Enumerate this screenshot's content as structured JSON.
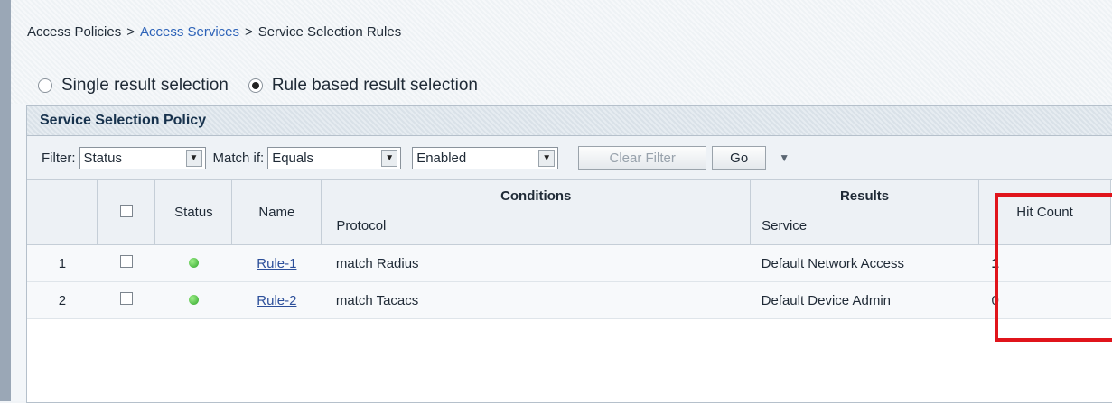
{
  "breadcrumb": {
    "item1": "Access Policies",
    "item2": "Access Services",
    "item3": "Service Selection Rules",
    "separator": ">"
  },
  "selection_mode": {
    "single": "Single result selection",
    "rule_based": "Rule based result selection",
    "selected": "rule_based"
  },
  "panel": {
    "title": "Service Selection Policy"
  },
  "filter": {
    "label": "Filter:",
    "field_value": "Status",
    "match_label": "Match if:",
    "operator_value": "Equals",
    "value_value": "Enabled",
    "clear_label": "Clear Filter",
    "go_label": "Go"
  },
  "table": {
    "headers": {
      "status": "Status",
      "name": "Name",
      "conditions": "Conditions",
      "protocol": "Protocol",
      "results": "Results",
      "service": "Service",
      "hit_count": "Hit Count"
    },
    "rows": [
      {
        "num": "1",
        "name": "Rule-1",
        "protocol": "match Radius",
        "service": "Default Network Access",
        "hit_count": "1"
      },
      {
        "num": "2",
        "name": "Rule-2",
        "protocol": "match Tacacs",
        "service": "Default Device Admin",
        "hit_count": "0"
      }
    ]
  },
  "colors": {
    "highlight": "#e0141b",
    "link": "#2c62b8",
    "status_enabled": "#2fa52a"
  }
}
